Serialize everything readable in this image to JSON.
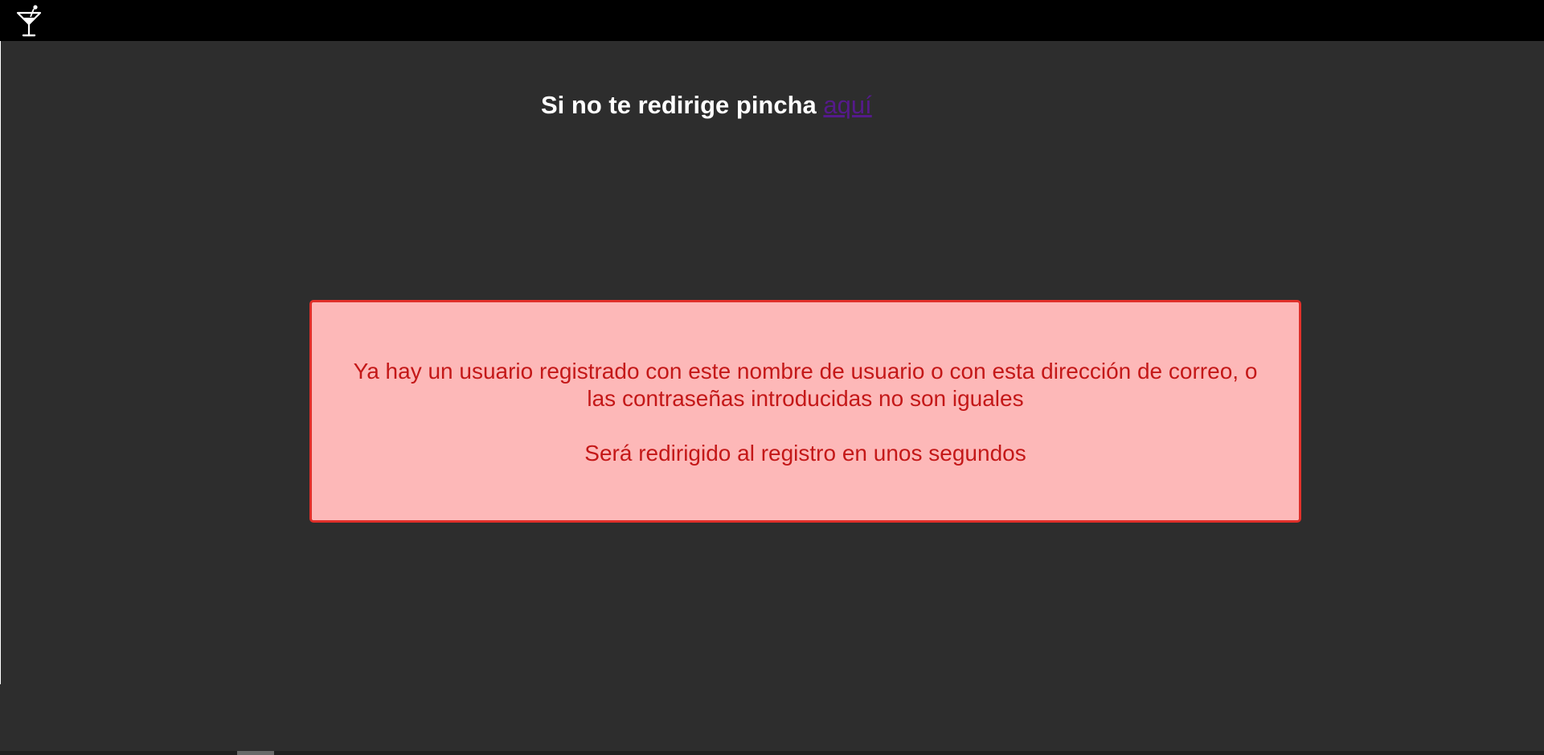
{
  "header": {
    "logo_icon": "cocktail-glass-icon"
  },
  "redirect": {
    "text": "Si no te redirige pincha ",
    "link_label": "aquí",
    "link_color": "#551a8b"
  },
  "alert": {
    "message": "Ya hay un usuario registrado con este nombre de usuario o con esta dirección de correo, o las contraseñas introducidas no son iguales",
    "subtext": "Será redirigido al registro en unos segundos",
    "background": "#fdb8b8",
    "border_color": "#e0302a",
    "text_color": "#c41818"
  },
  "colors": {
    "page_background": "#2d2d2d",
    "topbar_background": "#000000"
  }
}
